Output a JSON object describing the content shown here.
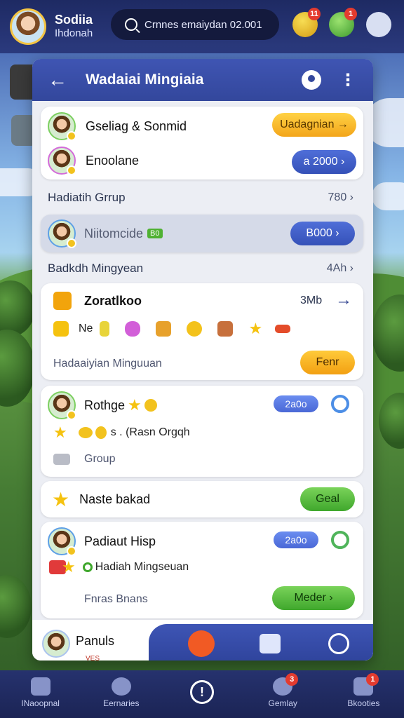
{
  "topbar": {
    "user_name": "Sodiia",
    "user_sub": "Ihdonah",
    "search_text": "Crnnes emaiydan 02.001",
    "badges": [
      "11",
      "1"
    ]
  },
  "panel": {
    "title": "Wadaiai Mingiaia",
    "back_icon": "←",
    "menu_icon": "⋮",
    "card1": {
      "row1_name": "Gseliag & Sonmid",
      "row1_button": "Uadagnian →",
      "row2_name": "Enoolane",
      "row2_button": "a 2000 ›"
    },
    "section1": {
      "label": "Hadiatih Grrup",
      "meta": "780 ›"
    },
    "highlight": {
      "name": "Niitomcide",
      "tag": "B0",
      "button": "B000 ›"
    },
    "section2": {
      "label": "Badkdh Mingyean",
      "meta": "4Ah ›"
    },
    "rewards": {
      "title": "Zoratlkoo",
      "meta": "3Mb",
      "arrow": "→",
      "items_label": "Ne",
      "footer": "Hadaaiyian Minguuan",
      "button": "Fenr"
    },
    "card_rothge": {
      "name": "Rothge",
      "pill": "2a0o",
      "line2": "s . (Rasn Orgqh",
      "line3": "Group"
    },
    "card_naste": {
      "name": "Naste bakad",
      "button": "Geal"
    },
    "card_padiaut": {
      "name": "Padiaut Hisp",
      "pill": "2a0o",
      "line2": "Hadiah Mingseuan",
      "footer": "Fnras Bnans",
      "button": "Meder ›"
    },
    "bottom_user": {
      "name": "Panuls",
      "sub": "VES"
    }
  },
  "bottomnav": {
    "items": [
      {
        "label": "INaoopnal"
      },
      {
        "label": "Eernaries"
      },
      {
        "label": ""
      },
      {
        "label": "Gemlay"
      },
      {
        "label": "Bkooties"
      }
    ],
    "badges": [
      "3",
      "1"
    ]
  },
  "colors": {
    "header_blue": "#33479c",
    "accent_yellow": "#f3a51a",
    "accent_green": "#3fa72c",
    "accent_blue": "#3551b8",
    "accent_orange": "#f15a24"
  }
}
